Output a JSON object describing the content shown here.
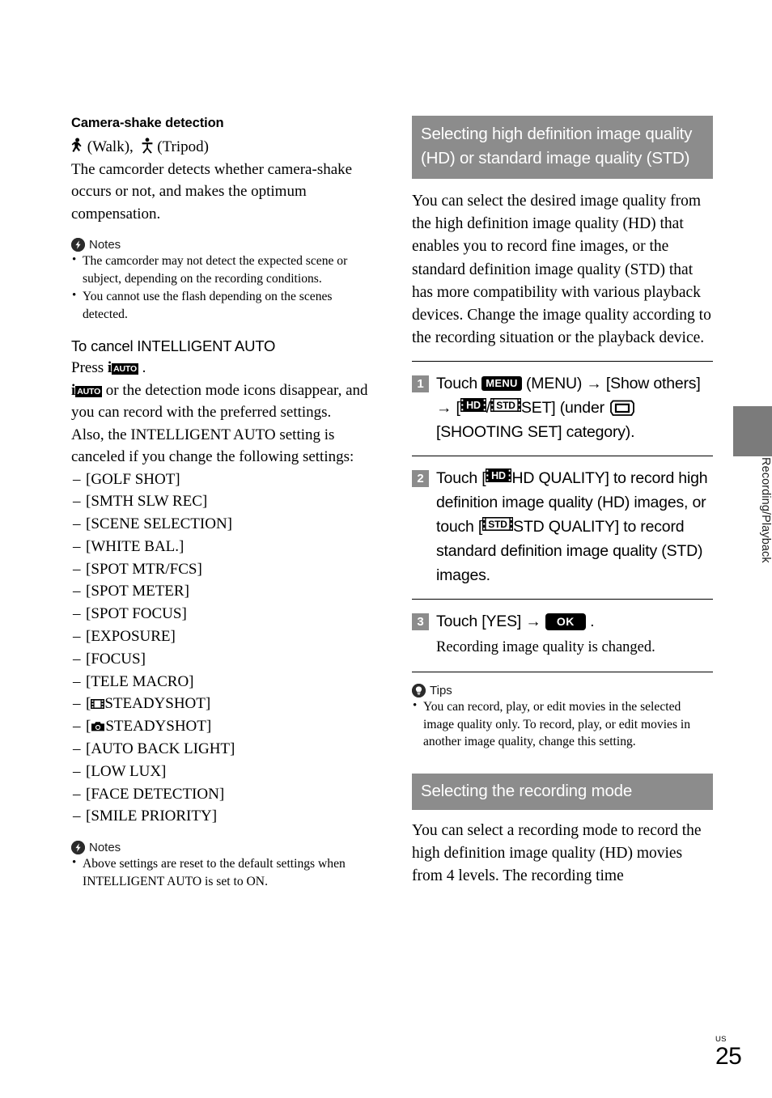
{
  "left_column": {
    "heading": "Camera-shake detection",
    "icon_line": {
      "walk_icon": "walk-person-icon",
      "walk_label": "(Walk),",
      "tripod_icon": "tripod-person-icon",
      "tripod_label": "(Tripod)"
    },
    "intro_paragraph": "The camcorder detects whether camera-shake occurs or not, and makes the optimum compensation.",
    "notes_1": {
      "icon": "notes-lightning-icon",
      "label": "Notes",
      "items": [
        "The camcorder may not detect the expected scene or subject, depending on the recording conditions.",
        "You cannot use the flash depending on the scenes detected."
      ]
    },
    "cancel_heading": "To cancel INTELLIGENT AUTO",
    "press_prefix": "Press",
    "press_icon_i": "i",
    "press_icon_auto": "AUTO",
    "press_suffix": ".",
    "disappear_text": "or the detection mode icons disappear, and you can record with the preferred settings.",
    "also_text": "Also, the INTELLIGENT AUTO setting is canceled if you change the following settings:",
    "settings_list": [
      {
        "icon": "",
        "label": "[GOLF SHOT]"
      },
      {
        "icon": "",
        "label": "[SMTH SLW REC]"
      },
      {
        "icon": "",
        "label": "[SCENE SELECTION]"
      },
      {
        "icon": "",
        "label": "[WHITE BAL.]"
      },
      {
        "icon": "",
        "label": "[SPOT MTR/FCS]"
      },
      {
        "icon": "",
        "label": "[SPOT METER]"
      },
      {
        "icon": "",
        "label": "[SPOT FOCUS]"
      },
      {
        "icon": "",
        "label": "[EXPOSURE]"
      },
      {
        "icon": "",
        "label": "[FOCUS]"
      },
      {
        "icon": "",
        "label": "[TELE MACRO]"
      },
      {
        "icon": "movie-film-icon",
        "label": "STEADYSHOT]",
        "bracket_open": "["
      },
      {
        "icon": "photo-camera-icon",
        "label": "STEADYSHOT]",
        "bracket_open": "["
      },
      {
        "icon": "",
        "label": "[AUTO BACK LIGHT]"
      },
      {
        "icon": "",
        "label": "[LOW LUX]"
      },
      {
        "icon": "",
        "label": "[FACE DETECTION]"
      },
      {
        "icon": "",
        "label": "[SMILE PRIORITY]"
      }
    ],
    "notes_2": {
      "icon": "notes-lightning-icon",
      "label": "Notes",
      "items": [
        "Above settings are reset to the default settings when INTELLIGENT AUTO is set to ON."
      ]
    }
  },
  "right_column": {
    "banner_1": "Selecting high definition image quality (HD) or standard image quality (STD)",
    "intro": "You can select the desired image quality from the high definition image quality (HD) that enables you to record fine images, or the standard definition image quality (STD) that has more compatibility with various playback devices. Change the image quality according to the recording situation or the playback device.",
    "steps": [
      {
        "number": "1",
        "text_1": "Touch",
        "badge_menu": "MENU",
        "text_2": "(MENU)",
        "arrow": "→",
        "text_3": "[Show others]",
        "arrow_2": "→",
        "text_4": "[",
        "badge_hd": "HD",
        "text_5": "/",
        "badge_std": "STD",
        "text_6": "SET] (under",
        "icon_shooting": "shooting-set-camcorder-icon",
        "text_7": "[SHOOTING SET] category)."
      },
      {
        "number": "2",
        "text_1": "Touch [",
        "badge_hd": "HD",
        "text_2": "HD QUALITY] to record high definition image quality (HD) images, or touch [",
        "badge_std": "STD",
        "text_3": "STD QUALITY] to record standard definition image quality (STD) images."
      },
      {
        "number": "3",
        "text_1": "Touch [YES]",
        "arrow": "→",
        "badge_ok": "OK",
        "text_2": ".",
        "subtext": "Recording image quality is changed."
      }
    ],
    "tips": {
      "icon": "tips-lightbulb-icon",
      "label": "Tips",
      "items": [
        "You can record, play, or edit movies in the selected image quality only. To record, play, or edit movies in another image quality, change this setting."
      ]
    },
    "banner_2": "Selecting the recording mode",
    "closing": "You can select a recording mode to record the high definition image quality (HD) movies from 4 levels. The recording time"
  },
  "side_tab": {
    "label": "Recording/Playback"
  },
  "folio": {
    "region": "US",
    "page": "25"
  },
  "colors": {
    "banner_gray": "#8c8c8c",
    "tab_gray": "#7b7b7b",
    "badge_black": "#000000",
    "text_black": "#000000"
  }
}
